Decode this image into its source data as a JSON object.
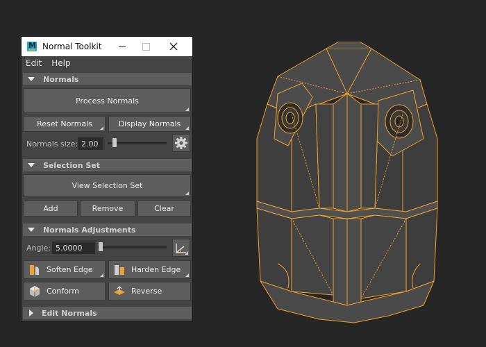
{
  "window": {
    "title": "Normal Toolkit"
  },
  "menu": [
    "Edit",
    "Help"
  ],
  "sections": {
    "normals": "Normals",
    "selection_set": "Selection Set",
    "normals_adjustments": "Normals Adjustments",
    "edit_normals": "Edit Normals"
  },
  "buttons": {
    "process_normals": "Process Normals",
    "reset_normals": "Reset Normals",
    "display_normals": "Display Normals",
    "view_selection_set": "View Selection Set",
    "add": "Add",
    "remove": "Remove",
    "clear": "Clear",
    "soften_edge": "Soften Edge",
    "harden_edge": "Harden Edge",
    "conform": "Conform",
    "reverse": "Reverse"
  },
  "normals_size": {
    "label": "Normals size:",
    "value": "2.00"
  },
  "angle": {
    "label": "Angle:",
    "value": "5.0000"
  },
  "icons": [
    "maya-app-icon",
    "minimize-icon",
    "maximize-icon",
    "close-icon",
    "gear-icon",
    "angle-icon",
    "soften-edge-icon",
    "harden-edge-icon",
    "conform-icon",
    "reverse-icon"
  ],
  "colors": {
    "wire": "#f0a22b",
    "mesh": "#444444",
    "panel": "#444444",
    "section": "#5d5d5d"
  }
}
